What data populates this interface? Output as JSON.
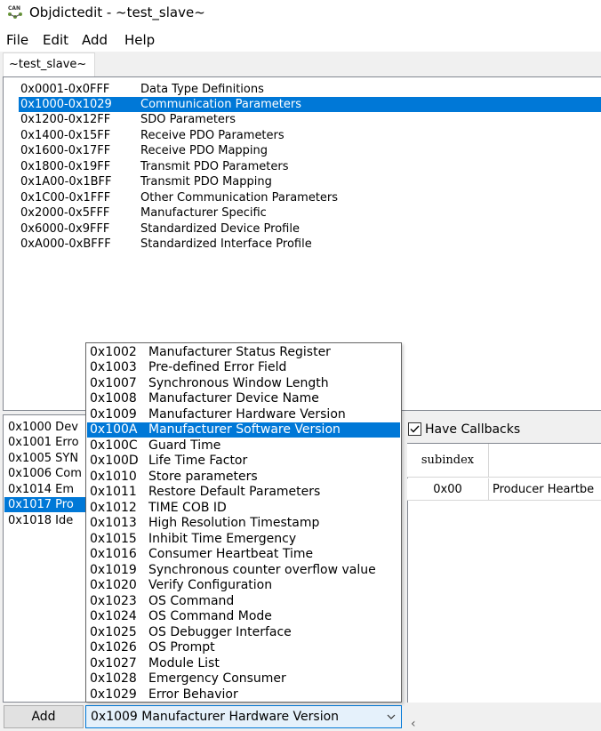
{
  "window": {
    "title": "Objdictedit - ~test_slave~",
    "icon": "can-app-icon"
  },
  "menu": [
    "File",
    "Edit",
    "Add",
    "Help"
  ],
  "tab": {
    "label": "~test_slave~"
  },
  "ranges": [
    {
      "code": "0x0001-0x0FFF",
      "name": "Data Type Definitions"
    },
    {
      "code": "0x1000-0x1029",
      "name": "Communication Parameters",
      "selected": true
    },
    {
      "code": "0x1200-0x12FF",
      "name": "SDO Parameters"
    },
    {
      "code": "0x1400-0x15FF",
      "name": "Receive PDO Parameters"
    },
    {
      "code": "0x1600-0x17FF",
      "name": "Receive PDO Mapping"
    },
    {
      "code": "0x1800-0x19FF",
      "name": "Transmit PDO Parameters"
    },
    {
      "code": "0x1A00-0x1BFF",
      "name": "Transmit PDO Mapping"
    },
    {
      "code": "0x1C00-0x1FFF",
      "name": "Other Communication Parameters"
    },
    {
      "code": "0x2000-0x5FFF",
      "name": "Manufacturer Specific"
    },
    {
      "code": "0x6000-0x9FFF",
      "name": "Standardized Device Profile"
    },
    {
      "code": "0xA000-0xBFFF",
      "name": "Standardized Interface Profile"
    }
  ],
  "index_list": [
    {
      "text": "0x1000  Dev"
    },
    {
      "text": "0x1001  Erro"
    },
    {
      "text": "0x1005  SYN"
    },
    {
      "text": "0x1006  Com"
    },
    {
      "text": "0x1014  Em"
    },
    {
      "text": "0x1017  Pro",
      "selected": true
    },
    {
      "text": "0x1018  Ide"
    }
  ],
  "callbacks": {
    "label": "Have Callbacks",
    "checked": true
  },
  "grid": {
    "columns": [
      "subindex",
      ""
    ],
    "rows": [
      {
        "subindex": "0x00",
        "name": "Producer Heartbe"
      }
    ]
  },
  "add_button": {
    "label": "Add"
  },
  "combo": {
    "value": "0x1009  Manufacturer Hardware Version"
  },
  "dropdown_items": [
    {
      "code": "0x1002",
      "name": "Manufacturer Status Register"
    },
    {
      "code": "0x1003",
      "name": "Pre-defined Error Field"
    },
    {
      "code": "0x1007",
      "name": "Synchronous Window Length"
    },
    {
      "code": "0x1008",
      "name": "Manufacturer Device Name"
    },
    {
      "code": "0x1009",
      "name": "Manufacturer Hardware Version"
    },
    {
      "code": "0x100A",
      "name": "Manufacturer Software Version",
      "selected": true
    },
    {
      "code": "0x100C",
      "name": "Guard Time"
    },
    {
      "code": "0x100D",
      "name": "Life Time Factor"
    },
    {
      "code": "0x1010",
      "name": "Store parameters"
    },
    {
      "code": "0x1011",
      "name": "Restore Default Parameters"
    },
    {
      "code": "0x1012",
      "name": "TIME COB ID"
    },
    {
      "code": "0x1013",
      "name": "High Resolution Timestamp"
    },
    {
      "code": "0x1015",
      "name": "Inhibit Time Emergency"
    },
    {
      "code": "0x1016",
      "name": "Consumer Heartbeat Time"
    },
    {
      "code": "0x1019",
      "name": "Synchronous counter overflow value"
    },
    {
      "code": "0x1020",
      "name": "Verify Configuration"
    },
    {
      "code": "0x1023",
      "name": "OS Command"
    },
    {
      "code": "0x1024",
      "name": "OS Command Mode"
    },
    {
      "code": "0x1025",
      "name": "OS Debugger Interface"
    },
    {
      "code": "0x1026",
      "name": "OS Prompt"
    },
    {
      "code": "0x1027",
      "name": "Module List"
    },
    {
      "code": "0x1028",
      "name": "Emergency Consumer"
    },
    {
      "code": "0x1029",
      "name": "Error Behavior"
    }
  ],
  "colors": {
    "selection": "#0078d7",
    "window_bg": "#f0f0f0",
    "combo_bg": "#e5f1fb"
  }
}
